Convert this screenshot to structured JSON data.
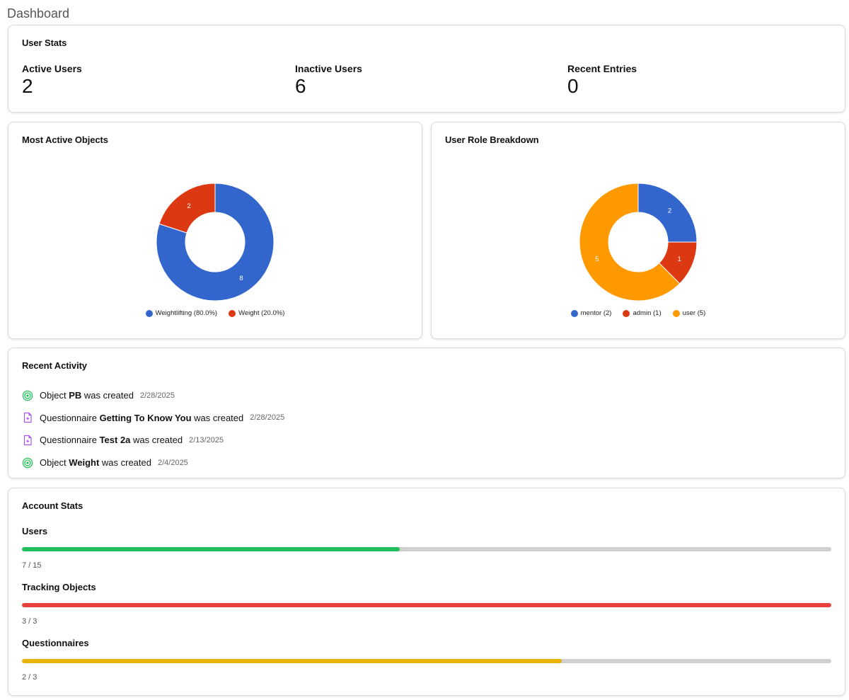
{
  "page_title": "Dashboard",
  "user_stats": {
    "title": "User Stats",
    "items": [
      {
        "label": "Active Users",
        "value": "2"
      },
      {
        "label": "Inactive Users",
        "value": "6"
      },
      {
        "label": "Recent Entries",
        "value": "0"
      }
    ]
  },
  "most_active_objects": {
    "title": "Most Active Objects",
    "chart_data": {
      "type": "pie",
      "donut": true,
      "categories": [
        "Weightlifting",
        "Weight"
      ],
      "values": [
        8,
        2
      ],
      "slice_labels": [
        "8",
        "2"
      ],
      "legend": [
        "Weightlifting (80.0%)",
        "Weight (20.0%)"
      ],
      "colors": [
        "#3366cc",
        "#dc3912"
      ],
      "legend_position": "bottom"
    }
  },
  "user_role_breakdown": {
    "title": "User Role Breakdown",
    "chart_data": {
      "type": "pie",
      "donut": true,
      "categories": [
        "mentor",
        "admin",
        "user"
      ],
      "values": [
        2,
        1,
        5
      ],
      "slice_labels": [
        "2",
        "1",
        "5"
      ],
      "legend": [
        "mentor (2)",
        "admin (1)",
        "user (5)"
      ],
      "colors": [
        "#3366cc",
        "#dc3912",
        "#ff9900"
      ],
      "legend_position": "bottom"
    }
  },
  "recent_activity": {
    "title": "Recent Activity",
    "items": [
      {
        "icon": "target-icon",
        "type": "Object",
        "name": "PB",
        "suffix": "was created",
        "date": "2/28/2025"
      },
      {
        "icon": "file-plus-icon",
        "type": "Questionnaire",
        "name": "Getting To Know You",
        "suffix": "was created",
        "date": "2/28/2025"
      },
      {
        "icon": "file-plus-icon",
        "type": "Questionnaire",
        "name": "Test 2a",
        "suffix": "was created",
        "date": "2/13/2025"
      },
      {
        "icon": "target-icon",
        "type": "Object",
        "name": "Weight",
        "suffix": "was created",
        "date": "2/4/2025"
      }
    ]
  },
  "account_stats": {
    "title": "Account Stats",
    "items": [
      {
        "label": "Users",
        "used": 7,
        "total": 15,
        "count_text": "7 / 15",
        "color": "#22c05a"
      },
      {
        "label": "Tracking Objects",
        "used": 3,
        "total": 3,
        "count_text": "3 / 3",
        "color": "#e8403c"
      },
      {
        "label": "Questionnaires",
        "used": 2,
        "total": 3,
        "count_text": "2 / 3",
        "color": "#eab308"
      }
    ]
  },
  "colors": {
    "object_icon": "#22c05a",
    "questionnaire_icon": "#a855f7"
  }
}
